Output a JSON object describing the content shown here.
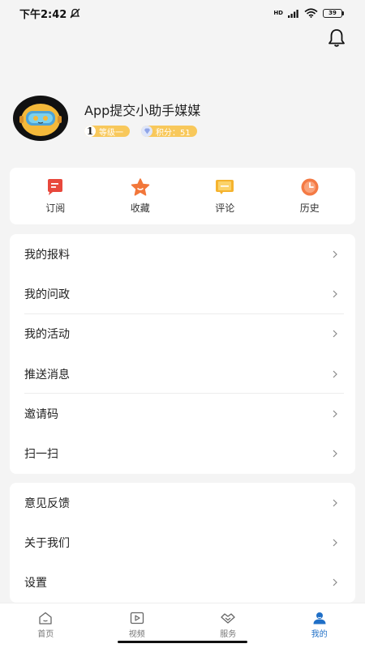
{
  "status_bar": {
    "time": "下午2:42",
    "network": "HD",
    "battery": "39"
  },
  "profile": {
    "username": "App提交小助手媒媒",
    "level_number": "1",
    "level_label": "等级一",
    "points_label": "积分：51"
  },
  "quick_actions": [
    {
      "label": "订阅",
      "icon": "subscribe-icon"
    },
    {
      "label": "收藏",
      "icon": "star-icon"
    },
    {
      "label": "评论",
      "icon": "comment-icon"
    },
    {
      "label": "历史",
      "icon": "clock-icon"
    }
  ],
  "menu_group_1": [
    {
      "label": "我的报料"
    },
    {
      "label": "我的问政"
    },
    {
      "label": "我的活动"
    },
    {
      "label": "推送消息"
    },
    {
      "label": "邀请码"
    },
    {
      "label": "扫一扫"
    }
  ],
  "menu_group_2": [
    {
      "label": "意见反馈"
    },
    {
      "label": "关于我们"
    },
    {
      "label": "设置"
    }
  ],
  "bottom_nav": [
    {
      "label": "首页",
      "icon": "home-icon",
      "active": false
    },
    {
      "label": "视频",
      "icon": "video-icon",
      "active": false
    },
    {
      "label": "服务",
      "icon": "handshake-icon",
      "active": false
    },
    {
      "label": "我的",
      "icon": "person-icon",
      "active": true
    }
  ],
  "colors": {
    "accent_active": "#1f6fc7",
    "level_badge": "#f8c85b",
    "subscribe": "#e8483c",
    "star": "#f2773a",
    "comment": "#f5b32e",
    "history": "#f47a44"
  }
}
